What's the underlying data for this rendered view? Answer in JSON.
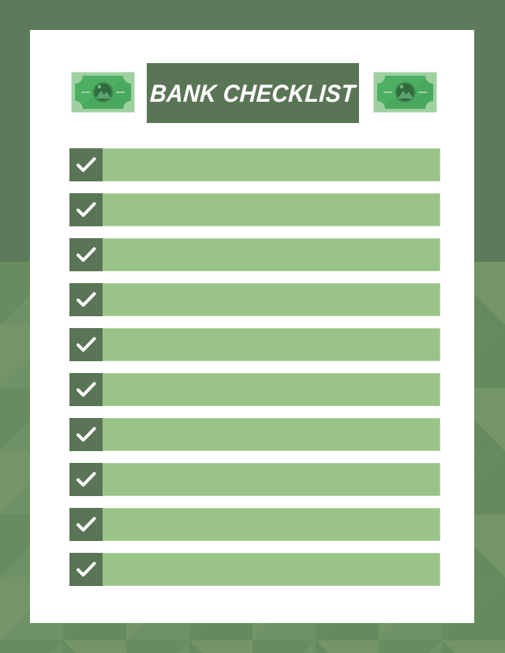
{
  "document": {
    "title": "BANK CHECKLIST",
    "type": "checklist-poster"
  },
  "theme": {
    "background_dark": "#5d7a5a",
    "background_light": "#6f9167",
    "sheet": "#ffffff",
    "band_dark_green": "#5a7555",
    "row_green": "#9ac387",
    "row_border": "#b7d4a8",
    "check_white": "#ffffff",
    "bill_border": "#9fd0a0",
    "bill_fill": "#4caf62",
    "bill_emblem": "#2f6b3d"
  },
  "header": {
    "title": "BANK CHECKLIST",
    "left_icon": "money-bill-icon",
    "right_icon": "money-bill-icon"
  },
  "checklist": {
    "item_count": 10,
    "checkbox_icon": "check-mark-icon",
    "items": [
      {
        "checked": true,
        "label": ""
      },
      {
        "checked": true,
        "label": ""
      },
      {
        "checked": true,
        "label": ""
      },
      {
        "checked": true,
        "label": ""
      },
      {
        "checked": true,
        "label": ""
      },
      {
        "checked": true,
        "label": ""
      },
      {
        "checked": true,
        "label": ""
      },
      {
        "checked": true,
        "label": ""
      },
      {
        "checked": true,
        "label": ""
      },
      {
        "checked": true,
        "label": ""
      }
    ]
  }
}
